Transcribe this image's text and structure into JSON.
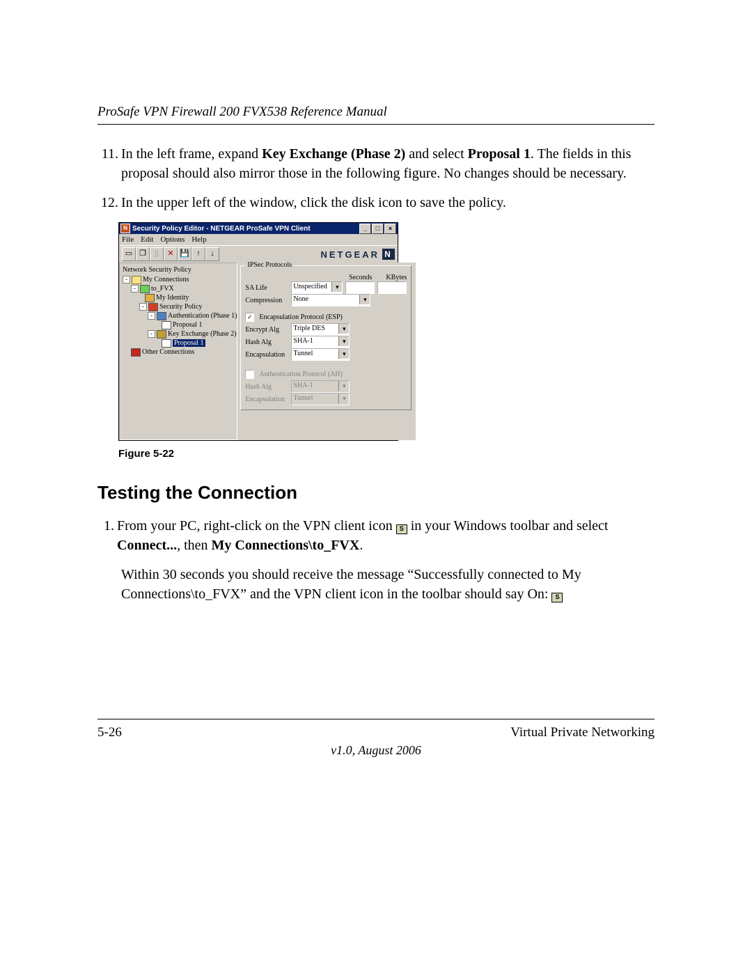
{
  "header": {
    "title": "ProSafe VPN Firewall 200 FVX538 Reference Manual"
  },
  "steps": {
    "s11": {
      "num": "11.",
      "t1": "In the left frame, expand ",
      "b1": "Key Exchange (Phase 2)",
      "t2": " and select ",
      "b2": "Proposal 1",
      "t3": ". The fields in this proposal should also mirror those in the following figure. No changes should be necessary."
    },
    "s12": {
      "num": "12.",
      "t1": "In the upper left of the window, click the disk icon to save the policy."
    }
  },
  "figcap": "Figure 5-22",
  "h2": "Testing the Connection",
  "test": {
    "s1": {
      "num": "1.",
      "t1": "From your PC, right-click on the VPN client icon ",
      "t2": " in your Windows toolbar and select ",
      "b1": "Connect...",
      "t3": ", then ",
      "b2": "My Connections\\to_FVX",
      "t4": "."
    },
    "p1": {
      "t1": "Within 30 seconds you should receive the message “Successfully connected to My Connections\\to_FVX” and the VPN client icon in the toolbar should say On: "
    }
  },
  "footer": {
    "left": "5-26",
    "right": "Virtual Private Networking",
    "ver": "v1.0, August 2006"
  },
  "win": {
    "title": "Security Policy Editor - NETGEAR ProSafe VPN Client",
    "menu": {
      "m0": "File",
      "m1": "Edit",
      "m2": "Options",
      "m3": "Help"
    },
    "brand": "NETGEAR",
    "tree": {
      "title": "Network Security Policy",
      "n0": "My Connections",
      "n1": "to_FVX",
      "n2": "My Identity",
      "n3": "Security Policy",
      "n4": "Authentication (Phase 1)",
      "n5": "Proposal 1",
      "n6": "Key Exchange (Phase 2)",
      "n7": "Proposal 1",
      "n8": "Other Connections"
    },
    "props": {
      "g1": "IPSec Protocols",
      "sec": "Seconds",
      "kb": "KBytes",
      "salife": "SA Life",
      "salife_v": "Unspecified",
      "comp": "Compression",
      "comp_v": "None",
      "esp": "Encapsulation Protocol (ESP)",
      "enc": "Encrypt Alg",
      "enc_v": "Triple DES",
      "hash": "Hash Alg",
      "hash_v": "SHA-1",
      "encap": "Encapsulation",
      "encap_v": "Tunnel",
      "ah": "Authentication Protocol (AH)",
      "hash2": "Hash Alg",
      "hash2_v": "SHA-1",
      "encap2": "Encapsulation",
      "encap2_v": "Tunnel"
    }
  }
}
